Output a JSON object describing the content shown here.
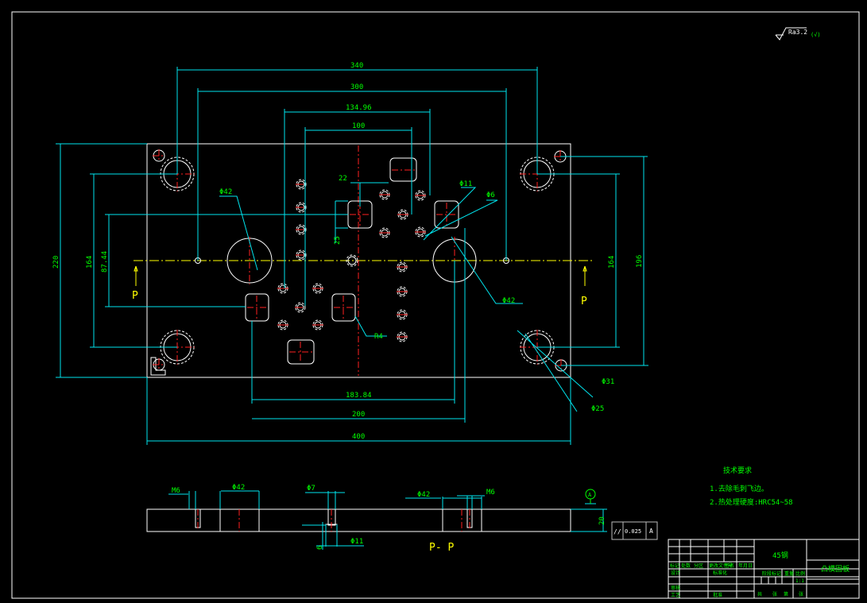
{
  "drawing": {
    "roughness": "Ra3.2",
    "roughness_note": "(√)",
    "colors": {
      "outline": "#ffffff",
      "dimension": "#00e5ee",
      "text": "#00ff00",
      "centerline": "#ff2020",
      "section_line": "#ffff00"
    },
    "plan_dims": {
      "d340": "340",
      "d300": "300",
      "d134": "134.96",
      "d100": "100",
      "d220": "220",
      "d164l": "164",
      "d87": "87.44",
      "d164r": "164",
      "d196": "196",
      "d183": "183.84",
      "d200": "200",
      "d400": "400",
      "d22": "22",
      "d25": "25"
    },
    "plan_labels": {
      "phi42_left": "Φ42",
      "phi11": "Φ11",
      "phi6": "Φ6",
      "phi42_right": "Φ42",
      "r4": "R4",
      "phi31": "Φ31",
      "phi25": "Φ25",
      "p_left": "P",
      "p_right": "P"
    },
    "section": {
      "title": "P- P",
      "m6_left": "M6",
      "phi42_left": "Φ42",
      "phi7": "Φ7",
      "phi42_right": "Φ42",
      "m6_right": "M6",
      "phi11": "Φ11",
      "depth6": "6",
      "thickness": "20",
      "datum": "A"
    },
    "tolerance": {
      "symbol": "//",
      "value": "0.025",
      "datum": "A"
    },
    "requirements": {
      "title": "技术要求",
      "item1": "1.去除毛刺飞边。",
      "item2": "2.热处理硬度:HRC54~58"
    },
    "title_block": {
      "material": "45钢",
      "part_name": "凸模固板",
      "headers": [
        "标记",
        "处数",
        "分区",
        "更改文件号",
        "签名",
        "年月日"
      ],
      "designer": "设计",
      "standard": "标准化",
      "review": "审核",
      "process": "工艺",
      "approve": "批准",
      "stage": "阶段标记",
      "weight": "重量",
      "scale": "比例",
      "scale_value": "1:1",
      "sheets": [
        "共",
        "张",
        "第",
        "张"
      ]
    }
  }
}
